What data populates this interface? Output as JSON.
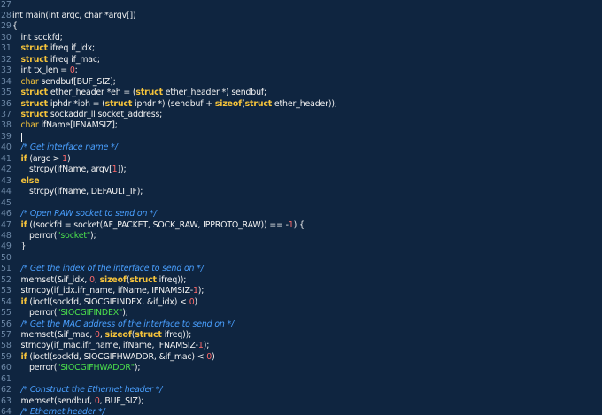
{
  "colors": {
    "background": "#0f2540",
    "gutter": "#6f8aa8",
    "plain": "#f2f2f2",
    "keyword": "#f5c33b",
    "number": "#ff6b6b",
    "string": "#4ce04c",
    "comment": "#4aa0ff"
  },
  "editor": {
    "lines": [
      {
        "num": "27",
        "indent": 0,
        "tokens": []
      },
      {
        "num": "28",
        "indent": 0,
        "tokens": [
          {
            "t": "int main(",
            "c": "plain"
          },
          {
            "t": "int",
            "c": "plain"
          },
          {
            "t": " argc, ",
            "c": "plain"
          },
          {
            "t": "char",
            "c": "plain"
          },
          {
            "t": " *argv[])",
            "c": "plain"
          }
        ]
      },
      {
        "num": "29",
        "indent": 0,
        "tokens": [
          {
            "t": "{",
            "c": "plain"
          }
        ]
      },
      {
        "num": "30",
        "indent": 1,
        "tokens": [
          {
            "t": "int",
            "c": "plain"
          },
          {
            "t": " sockfd;",
            "c": "plain"
          }
        ]
      },
      {
        "num": "31",
        "indent": 1,
        "tokens": [
          {
            "t": "struct",
            "c": "kw"
          },
          {
            "t": " ifreq if_idx;",
            "c": "plain"
          }
        ]
      },
      {
        "num": "32",
        "indent": 1,
        "tokens": [
          {
            "t": "struct",
            "c": "kw"
          },
          {
            "t": " ifreq if_mac;",
            "c": "plain"
          }
        ]
      },
      {
        "num": "33",
        "indent": 1,
        "tokens": [
          {
            "t": "int",
            "c": "plain"
          },
          {
            "t": " tx_len = ",
            "c": "plain"
          },
          {
            "t": "0",
            "c": "num"
          },
          {
            "t": ";",
            "c": "plain"
          }
        ]
      },
      {
        "num": "34",
        "indent": 1,
        "tokens": [
          {
            "t": "char",
            "c": "type"
          },
          {
            "t": " sendbuf[BUF_SIZ];",
            "c": "plain"
          }
        ]
      },
      {
        "num": "35",
        "indent": 1,
        "tokens": [
          {
            "t": "struct",
            "c": "kw"
          },
          {
            "t": " ether_header *eh = (",
            "c": "plain"
          },
          {
            "t": "struct",
            "c": "kw"
          },
          {
            "t": " ether_header *) sendbuf;",
            "c": "plain"
          }
        ]
      },
      {
        "num": "36",
        "indent": 1,
        "tokens": [
          {
            "t": "struct",
            "c": "kw"
          },
          {
            "t": " iphdr *iph = (",
            "c": "plain"
          },
          {
            "t": "struct",
            "c": "kw"
          },
          {
            "t": " iphdr *) (sendbuf + ",
            "c": "plain"
          },
          {
            "t": "sizeof",
            "c": "kw"
          },
          {
            "t": "(",
            "c": "plain"
          },
          {
            "t": "struct",
            "c": "kw"
          },
          {
            "t": " ether_header));",
            "c": "plain"
          }
        ]
      },
      {
        "num": "37",
        "indent": 1,
        "tokens": [
          {
            "t": "struct",
            "c": "kw"
          },
          {
            "t": " sockaddr_ll socket_address;",
            "c": "plain"
          }
        ]
      },
      {
        "num": "38",
        "indent": 1,
        "tokens": [
          {
            "t": "char",
            "c": "type"
          },
          {
            "t": " ifName[IFNAMSIZ];",
            "c": "plain"
          }
        ]
      },
      {
        "num": "39",
        "indent": 1,
        "tokens": [],
        "cursor": true
      },
      {
        "num": "40",
        "indent": 1,
        "tokens": [
          {
            "t": "/* Get interface name */",
            "c": "cm"
          }
        ]
      },
      {
        "num": "41",
        "indent": 1,
        "tokens": [
          {
            "t": "if",
            "c": "kw"
          },
          {
            "t": " (argc > ",
            "c": "plain"
          },
          {
            "t": "1",
            "c": "num"
          },
          {
            "t": ")",
            "c": "plain"
          }
        ]
      },
      {
        "num": "42",
        "indent": 2,
        "tokens": [
          {
            "t": "strcpy(ifName, argv[",
            "c": "plain"
          },
          {
            "t": "1",
            "c": "num"
          },
          {
            "t": "]);",
            "c": "plain"
          }
        ]
      },
      {
        "num": "43",
        "indent": 1,
        "tokens": [
          {
            "t": "else",
            "c": "kw"
          }
        ]
      },
      {
        "num": "44",
        "indent": 2,
        "tokens": [
          {
            "t": "strcpy(ifName, DEFAULT_IF);",
            "c": "plain"
          }
        ]
      },
      {
        "num": "45",
        "indent": 0,
        "tokens": []
      },
      {
        "num": "46",
        "indent": 1,
        "tokens": [
          {
            "t": "/* Open RAW socket to send on */",
            "c": "cm"
          }
        ]
      },
      {
        "num": "47",
        "indent": 1,
        "tokens": [
          {
            "t": "if",
            "c": "kw"
          },
          {
            "t": " ((sockfd = socket(AF_PACKET, SOCK_RAW, IPPROTO_RAW)) == -",
            "c": "plain"
          },
          {
            "t": "1",
            "c": "num"
          },
          {
            "t": ") {",
            "c": "plain"
          }
        ]
      },
      {
        "num": "48",
        "indent": 2,
        "tokens": [
          {
            "t": "perror(",
            "c": "plain"
          },
          {
            "t": "\"socket\"",
            "c": "str"
          },
          {
            "t": ");",
            "c": "plain"
          }
        ]
      },
      {
        "num": "49",
        "indent": 1,
        "tokens": [
          {
            "t": "}",
            "c": "plain"
          }
        ]
      },
      {
        "num": "50",
        "indent": 0,
        "tokens": []
      },
      {
        "num": "51",
        "indent": 1,
        "tokens": [
          {
            "t": "/* Get the index of the interface to send on */",
            "c": "cm"
          }
        ]
      },
      {
        "num": "52",
        "indent": 1,
        "tokens": [
          {
            "t": "memset(&if_idx, ",
            "c": "plain"
          },
          {
            "t": "0",
            "c": "num"
          },
          {
            "t": ", ",
            "c": "plain"
          },
          {
            "t": "sizeof",
            "c": "kw"
          },
          {
            "t": "(",
            "c": "plain"
          },
          {
            "t": "struct",
            "c": "kw"
          },
          {
            "t": " ifreq));",
            "c": "plain"
          }
        ]
      },
      {
        "num": "53",
        "indent": 1,
        "tokens": [
          {
            "t": "strncpy(if_idx.ifr_name, ifName, IFNAMSIZ-",
            "c": "plain"
          },
          {
            "t": "1",
            "c": "num"
          },
          {
            "t": ");",
            "c": "plain"
          }
        ]
      },
      {
        "num": "54",
        "indent": 1,
        "tokens": [
          {
            "t": "if",
            "c": "kw"
          },
          {
            "t": " (ioctl(sockfd, SIOCGIFINDEX, &if_idx) < ",
            "c": "plain"
          },
          {
            "t": "0",
            "c": "num"
          },
          {
            "t": ")",
            "c": "plain"
          }
        ]
      },
      {
        "num": "55",
        "indent": 2,
        "tokens": [
          {
            "t": "perror(",
            "c": "plain"
          },
          {
            "t": "\"SIOCGIFINDEX\"",
            "c": "str"
          },
          {
            "t": ");",
            "c": "plain"
          }
        ]
      },
      {
        "num": "56",
        "indent": 1,
        "tokens": [
          {
            "t": "/* Get the MAC address of the interface to send on */",
            "c": "cm"
          }
        ]
      },
      {
        "num": "57",
        "indent": 1,
        "tokens": [
          {
            "t": "memset(&if_mac, ",
            "c": "plain"
          },
          {
            "t": "0",
            "c": "num"
          },
          {
            "t": ", ",
            "c": "plain"
          },
          {
            "t": "sizeof",
            "c": "kw"
          },
          {
            "t": "(",
            "c": "plain"
          },
          {
            "t": "struct",
            "c": "kw"
          },
          {
            "t": " ifreq));",
            "c": "plain"
          }
        ]
      },
      {
        "num": "58",
        "indent": 1,
        "tokens": [
          {
            "t": "strncpy(if_mac.ifr_name, ifName, IFNAMSIZ-",
            "c": "plain"
          },
          {
            "t": "1",
            "c": "num"
          },
          {
            "t": ");",
            "c": "plain"
          }
        ]
      },
      {
        "num": "59",
        "indent": 1,
        "tokens": [
          {
            "t": "if",
            "c": "kw"
          },
          {
            "t": " (ioctl(sockfd, SIOCGIFHWADDR, &if_mac) < ",
            "c": "plain"
          },
          {
            "t": "0",
            "c": "num"
          },
          {
            "t": ")",
            "c": "plain"
          }
        ]
      },
      {
        "num": "60",
        "indent": 2,
        "tokens": [
          {
            "t": "perror(",
            "c": "plain"
          },
          {
            "t": "\"SIOCGIFHWADDR\"",
            "c": "str"
          },
          {
            "t": ");",
            "c": "plain"
          }
        ]
      },
      {
        "num": "61",
        "indent": 0,
        "tokens": []
      },
      {
        "num": "62",
        "indent": 1,
        "tokens": [
          {
            "t": "/* Construct the Ethernet header */",
            "c": "cm"
          }
        ]
      },
      {
        "num": "63",
        "indent": 1,
        "tokens": [
          {
            "t": "memset(sendbuf, ",
            "c": "plain"
          },
          {
            "t": "0",
            "c": "num"
          },
          {
            "t": ", BUF_SIZ);",
            "c": "plain"
          }
        ]
      },
      {
        "num": "64",
        "indent": 1,
        "tokens": [
          {
            "t": "/* Ethernet header */",
            "c": "cm"
          }
        ]
      }
    ]
  }
}
